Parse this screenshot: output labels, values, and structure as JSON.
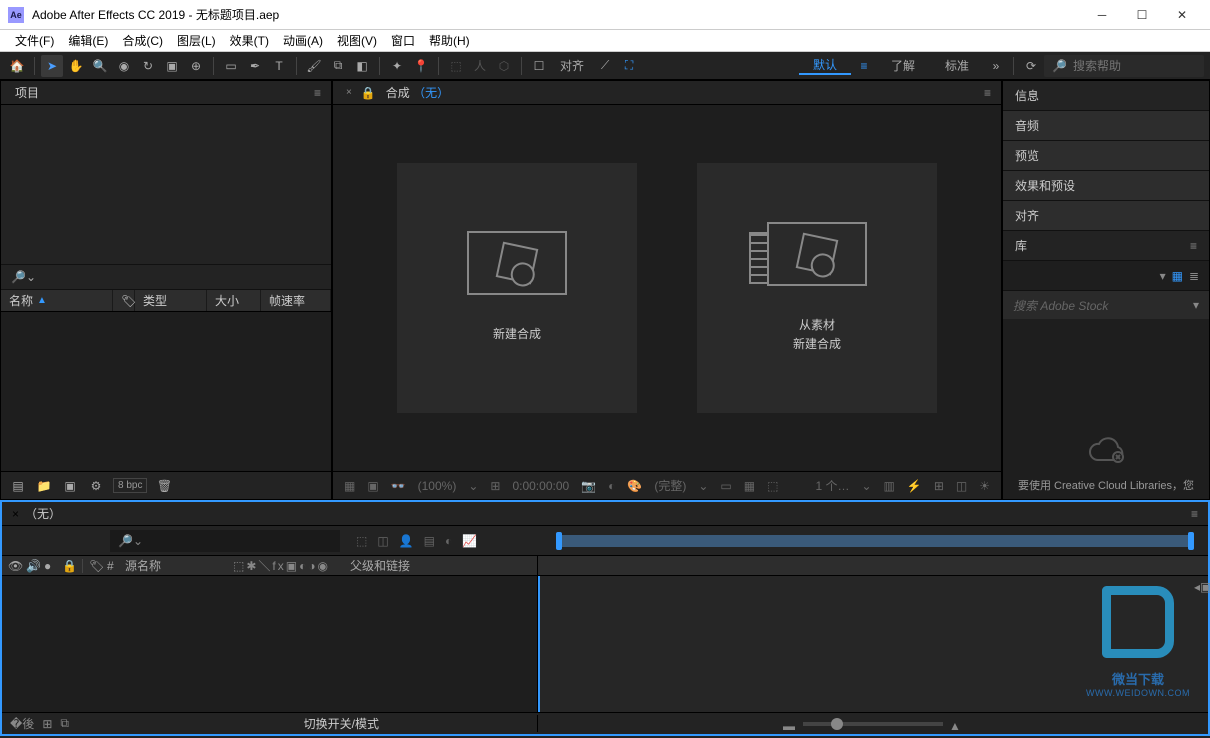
{
  "window": {
    "title": "Adobe After Effects CC 2019 - 无标题项目.aep",
    "icon_label": "Ae"
  },
  "menu": {
    "items": [
      "文件(F)",
      "编辑(E)",
      "合成(C)",
      "图层(L)",
      "效果(T)",
      "动画(A)",
      "视图(V)",
      "窗口",
      "帮助(H)"
    ]
  },
  "toolbar": {
    "align_label": "对齐",
    "workspaces": {
      "default": "默认",
      "learn": "了解",
      "standard": "标准"
    },
    "search_placeholder": "搜索帮助"
  },
  "project_panel": {
    "title": "项目",
    "columns": {
      "name": "名称",
      "tag_icon": "🏷",
      "type": "类型",
      "size": "大小",
      "framerate": "帧速率"
    },
    "bpc": "8 bpc"
  },
  "composition_panel": {
    "tab_prefix": "合成",
    "tab_none": "（无）",
    "card_new_comp": "新建合成",
    "card_from_footage_l1": "从素材",
    "card_from_footage_l2": "新建合成",
    "footer": {
      "zoom": "(100%)",
      "time": "0:00:00:00",
      "full": "(完整)",
      "view": "1 个…"
    }
  },
  "right_panels": {
    "info": "信息",
    "audio": "音频",
    "preview": "预览",
    "effects": "效果和预设",
    "align": "对齐",
    "library": "库",
    "lib_search": "搜索 Adobe Stock",
    "lib_cloud_msg": "要使用 Creative Cloud Libraries，您"
  },
  "timeline": {
    "tab": "（无）",
    "columns": {
      "source_name": "源名称",
      "parent_link": "父级和链接"
    },
    "footer_label": "切换开关/模式"
  },
  "watermark": {
    "line1": "微当下载",
    "line2": "WWW.WEIDOWN.COM"
  }
}
